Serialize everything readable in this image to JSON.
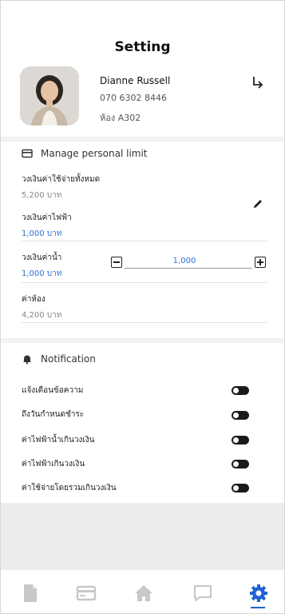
{
  "header": {
    "title": "Setting"
  },
  "profile": {
    "name": "Dianne Russell",
    "phone": "070 6302 8446",
    "room": "ห้อง A302"
  },
  "limits": {
    "title": "Manage personal limit",
    "items": [
      {
        "label": "วงเงินค่าใช้จ่ายทั้งหมด",
        "value": "5,200 บาท"
      },
      {
        "label": "วงเงินค่าไฟฟ้า",
        "value": "1,000 บาท"
      },
      {
        "label": "วงเงินค่าน้ำ",
        "value": "1,000 บาท"
      },
      {
        "label": "ค่าห้อง",
        "value": "4,200 บาท"
      }
    ],
    "stepper_value": "1,000"
  },
  "notification": {
    "title": "Notification",
    "items": [
      {
        "label": "แจ้งเตือนข้อความ",
        "enabled": false
      },
      {
        "label": "ถึงวันกำหนดชำระ",
        "enabled": false
      },
      {
        "label": "ค่าไฟฟ้าน้ำเกินวงเงิน",
        "enabled": false
      },
      {
        "label": "ค่าไฟฟ้าเกินวงเงิน",
        "enabled": false
      },
      {
        "label": "ค่าใช้จ่ายโดยรวมเกินวงเงิน",
        "enabled": false
      }
    ]
  },
  "nav": {
    "items": [
      "document-icon",
      "card-icon",
      "home-icon",
      "chat-icon",
      "settings-icon"
    ],
    "active": "settings-icon"
  },
  "colors": {
    "accent": "#1f63d4",
    "value_blue": "#2c6fd6",
    "icon_grey": "#c8c8c8"
  }
}
